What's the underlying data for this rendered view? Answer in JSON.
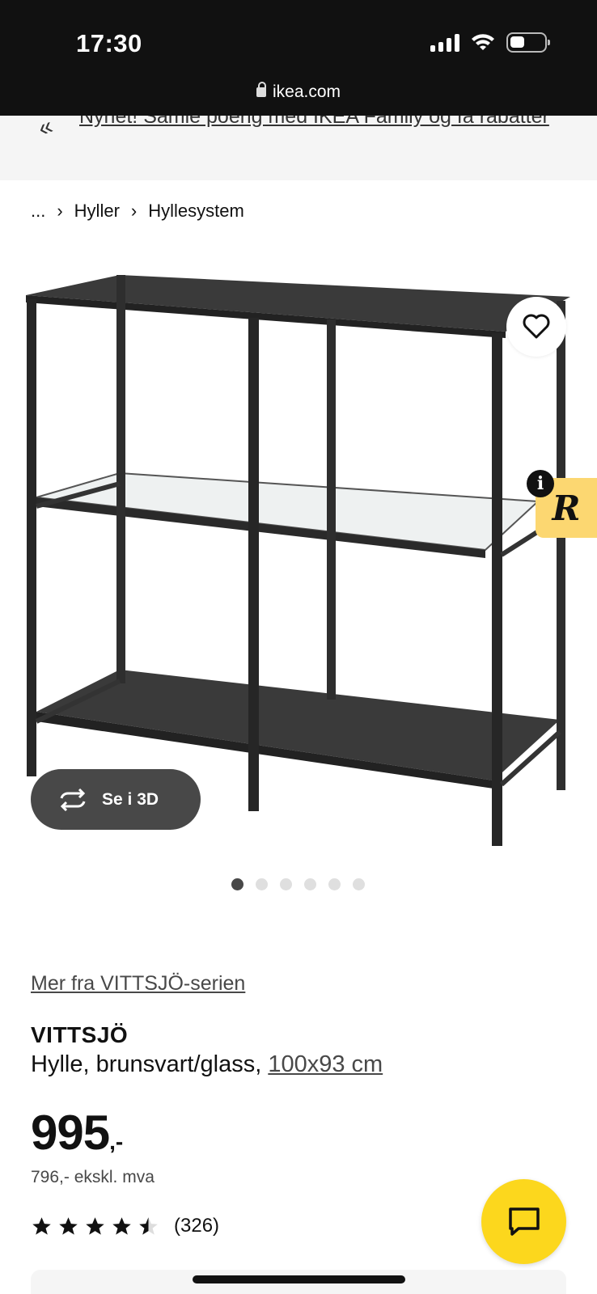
{
  "status_bar": {
    "time": "17:30"
  },
  "browser": {
    "url": "ikea.com"
  },
  "promo": {
    "text": "Nyhet! Samle poeng med IKEA Family og få rabatter",
    "icon": "arrow-left-icon"
  },
  "breadcrumb": {
    "items": [
      "...",
      "Hyller",
      "Hyllesystem"
    ]
  },
  "image": {
    "view_3d_label": "Se i 3D",
    "carousel_count": 6,
    "carousel_active": 0
  },
  "product": {
    "series_link": "Mer fra VITTSJÖ-serien",
    "name": "VITTSJÖ",
    "description": "Hylle, brunsvart/glass, ",
    "size": "100x93 cm",
    "price_main": "995",
    "price_suffix": ",-",
    "price_ex_vat": "796,- ekskl. mva",
    "rating": 4.5,
    "rating_count": "(326)"
  },
  "colors": {
    "accent_yellow": "#fcd71d",
    "badge_yellow": "#fcd771",
    "dark": "#111111"
  }
}
